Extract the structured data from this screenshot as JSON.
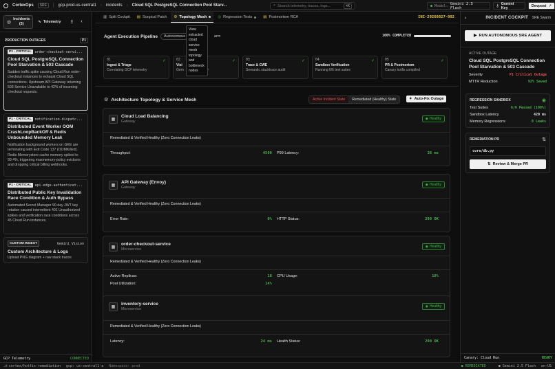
{
  "app": {
    "name": "CortexOps",
    "env_badge": "SRE",
    "project": "gcp-prod-us-central1",
    "section": "incidents",
    "incident_title": "Cloud SQL PostgreSQL Connection Pool Starv...",
    "search_placeholder": "Search telemetry, traces, logs...",
    "search_shortcut": "⌘K",
    "model_label": "Model:",
    "model": "Gemini 2.5 Flash",
    "key_button": "Gemini Key",
    "devpost_button": "Devpost"
  },
  "left": {
    "tab_incidents": "Incidents",
    "tab_incidents_count": "(3)",
    "tab_telemetry": "Telemetry",
    "section_title": "PRODUCTION OUTAGES",
    "section_badge": "P1",
    "incidents": [
      {
        "tag": "P1 - CRITICAL",
        "service": "order-checkout-servi...",
        "title": "Cloud SQL PostgreSQL Connection Pool Starvation & 503 Cascade",
        "desc": "Sudden traffic spike causing Cloud Run order-checkout instances to exhaust Cloud SQL connections. Upstream API Gateway returning 503 Service Unavailable to 42% of incoming checkout requests."
      },
      {
        "tag": "P1 - CRITICAL",
        "service": "notification-dispatc...",
        "title": "Distributed Event Worker OOM CrashLoopBackOff & Redis Unbounded Memory Leak",
        "desc": "Notification background workers on GKE are terminating with Exit Code 137 (OOMKilled). Redis Memorystore cache memory spiked to 99.4%, triggering maxmemory-policy evictions and dropping critical billing webhooks."
      },
      {
        "tag": "P1 - CRITICAL",
        "service": "api-edge-authenticat...",
        "title": "Distributed Public Key Invalidation Race Condition & Auth Bypass",
        "desc": "Automated Secret Manager 90-day JWT key rotation caused intermittent 401 Unauthorized spikes and verification race conditions across 45 Cloud Run instances."
      }
    ],
    "custom": {
      "tag": "CUSTOM INGEST",
      "model": "Gemini Vision",
      "title": "Custom Architecture & Logs",
      "desc": "Upload PNG diagram + raw stack traces"
    },
    "footer_label": "GCP Telemetry",
    "footer_status": "CONNECTED"
  },
  "tabs": [
    {
      "label": "Split Cockpit"
    },
    {
      "label": "Surgical Patch"
    },
    {
      "label": "Topology Mesh"
    },
    {
      "label": "Regression Tests"
    },
    {
      "label": "Postmortem RCA"
    }
  ],
  "incident_id": "INC-20260827-092",
  "tooltip": "View extracted cloud service mesh topology and bottleneck nodes",
  "pipeline": {
    "title": "Agent Execution Pipeline",
    "mode_pill": "Autonomous",
    "mode_suffix": "arm",
    "progress": "100% COMPLETED",
    "progress_value": 1.0,
    "steps": [
      {
        "n": "01",
        "t": "Ingest & Triage",
        "d": "Correlating GCP telemetry"
      },
      {
        "n": "02",
        "t": "Visi",
        "d": "Gem"
      },
      {
        "n": "03",
        "t": "Trace & CWE",
        "d": "Semantic stacktrace audit"
      },
      {
        "n": "04",
        "t": "Sandbox Verification",
        "d": "Running 6/6 test suites"
      },
      {
        "n": "05",
        "t": "PR & Postmortem",
        "d": "Canary hotfix compiled"
      }
    ],
    "step2_tail": "parser"
  },
  "topology": {
    "title": "Architecture Topology & Service Mesh",
    "btn_active": "Active Incident State",
    "btn_healthy": "Remediated (Healthy) State",
    "btn_autofix": "Auto-Fix Outage",
    "services": [
      {
        "name": "Cloud Load Balancing",
        "type": "Gateway",
        "status": "Healthy",
        "note": "Remediated & Verified Healthy (Zero Connection Leaks)",
        "metrics": [
          {
            "k": "Throughput:",
            "v": "4500"
          },
          {
            "k": "P99 Latency:",
            "v": "38 ms"
          }
        ]
      },
      {
        "name": "API Gateway (Envoy)",
        "type": "Gateway",
        "status": "Healthy",
        "note": "Remediated & Verified Healthy (Zero Connection Leaks)",
        "metrics": [
          {
            "k": "Error Rate:",
            "v": "0%"
          },
          {
            "k": "HTTP Status:",
            "v": "200 OK"
          }
        ]
      },
      {
        "name": "order-checkout-service",
        "type": "Microservice",
        "status": "Healthy",
        "note": "Remediated & Verified Healthy (Zero Connection Leaks)",
        "metrics": [
          {
            "k": "Active Replicas:",
            "v": "18"
          },
          {
            "k": "CPU Usage:",
            "v": "18%"
          },
          {
            "k": "Pool Utilization:",
            "v": "14%"
          }
        ]
      },
      {
        "name": "inventory-service",
        "type": "Microservice",
        "status": "Healthy",
        "note": "Remediated & Verified Healthy (Zero Connection Leaks)",
        "metrics": [
          {
            "k": "Latency:",
            "v": "24 ms"
          },
          {
            "k": "Health Status:",
            "v": "200 OK"
          }
        ]
      }
    ]
  },
  "right": {
    "title": "INCIDENT COCKPIT",
    "sub": "SRE Swarm",
    "run_button": "RUN AUTONOMOUS SRE AGENT",
    "outage": {
      "label": "ACTIVE OUTAGE",
      "title": "Cloud SQL PostgreSQL Connection Pool Starvation & 503 Cascade",
      "severity_k": "Severity",
      "severity_v": "P1 Critical Outage",
      "mttr_k": "MTTR Reduction",
      "mttr_v": "92% Saved"
    },
    "sandbox": {
      "label": "REGRESSION SANDBOX",
      "rows": [
        {
          "k": "Test Suites",
          "v": "6/6 Passed (100%)"
        },
        {
          "k": "Sandbox Latency",
          "v": "420 ms"
        },
        {
          "k": "Memory Regressions",
          "v": "0 Leaks"
        }
      ]
    },
    "pr": {
      "label": "REMEDIATION PR",
      "file": "core/db.py",
      "button": "Review & Merge PR"
    },
    "footer_k": "Canary: Cloud Run",
    "footer_v": "READY"
  },
  "status": {
    "branch": "cortex/hotfix-remediation",
    "gcp": "gcp: us-central1-a",
    "ns": "Namespace: prod",
    "remediated": "REMEDIATED",
    "model": "Gemini 2.5 Flash",
    "lang": "en-US"
  },
  "colors": {
    "healthy": "#4caf50",
    "critical": "#e05555",
    "accent_yellow": "#e8c547"
  }
}
